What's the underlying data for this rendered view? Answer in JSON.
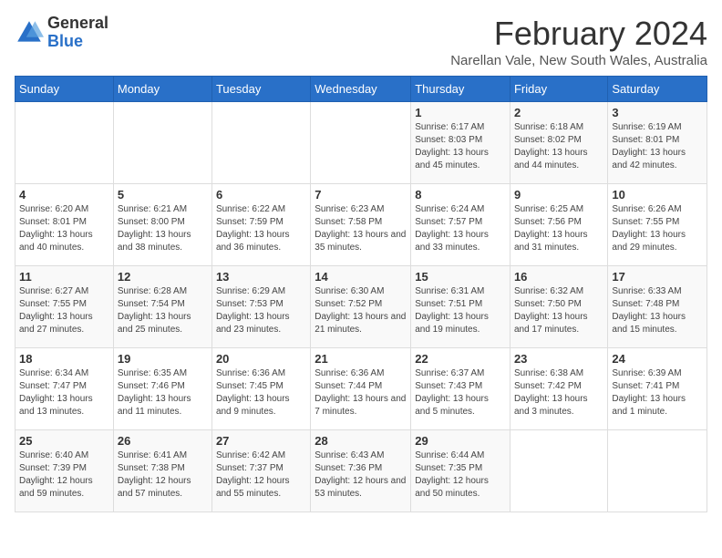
{
  "logo": {
    "general": "General",
    "blue": "Blue"
  },
  "title": "February 2024",
  "subtitle": "Narellan Vale, New South Wales, Australia",
  "days": [
    "Sunday",
    "Monday",
    "Tuesday",
    "Wednesday",
    "Thursday",
    "Friday",
    "Saturday"
  ],
  "weeks": [
    [
      {
        "date": "",
        "info": ""
      },
      {
        "date": "",
        "info": ""
      },
      {
        "date": "",
        "info": ""
      },
      {
        "date": "",
        "info": ""
      },
      {
        "date": "1",
        "info": "Sunrise: 6:17 AM\nSunset: 8:03 PM\nDaylight: 13 hours and 45 minutes."
      },
      {
        "date": "2",
        "info": "Sunrise: 6:18 AM\nSunset: 8:02 PM\nDaylight: 13 hours and 44 minutes."
      },
      {
        "date": "3",
        "info": "Sunrise: 6:19 AM\nSunset: 8:01 PM\nDaylight: 13 hours and 42 minutes."
      }
    ],
    [
      {
        "date": "4",
        "info": "Sunrise: 6:20 AM\nSunset: 8:01 PM\nDaylight: 13 hours and 40 minutes."
      },
      {
        "date": "5",
        "info": "Sunrise: 6:21 AM\nSunset: 8:00 PM\nDaylight: 13 hours and 38 minutes."
      },
      {
        "date": "6",
        "info": "Sunrise: 6:22 AM\nSunset: 7:59 PM\nDaylight: 13 hours and 36 minutes."
      },
      {
        "date": "7",
        "info": "Sunrise: 6:23 AM\nSunset: 7:58 PM\nDaylight: 13 hours and 35 minutes."
      },
      {
        "date": "8",
        "info": "Sunrise: 6:24 AM\nSunset: 7:57 PM\nDaylight: 13 hours and 33 minutes."
      },
      {
        "date": "9",
        "info": "Sunrise: 6:25 AM\nSunset: 7:56 PM\nDaylight: 13 hours and 31 minutes."
      },
      {
        "date": "10",
        "info": "Sunrise: 6:26 AM\nSunset: 7:55 PM\nDaylight: 13 hours and 29 minutes."
      }
    ],
    [
      {
        "date": "11",
        "info": "Sunrise: 6:27 AM\nSunset: 7:55 PM\nDaylight: 13 hours and 27 minutes."
      },
      {
        "date": "12",
        "info": "Sunrise: 6:28 AM\nSunset: 7:54 PM\nDaylight: 13 hours and 25 minutes."
      },
      {
        "date": "13",
        "info": "Sunrise: 6:29 AM\nSunset: 7:53 PM\nDaylight: 13 hours and 23 minutes."
      },
      {
        "date": "14",
        "info": "Sunrise: 6:30 AM\nSunset: 7:52 PM\nDaylight: 13 hours and 21 minutes."
      },
      {
        "date": "15",
        "info": "Sunrise: 6:31 AM\nSunset: 7:51 PM\nDaylight: 13 hours and 19 minutes."
      },
      {
        "date": "16",
        "info": "Sunrise: 6:32 AM\nSunset: 7:50 PM\nDaylight: 13 hours and 17 minutes."
      },
      {
        "date": "17",
        "info": "Sunrise: 6:33 AM\nSunset: 7:48 PM\nDaylight: 13 hours and 15 minutes."
      }
    ],
    [
      {
        "date": "18",
        "info": "Sunrise: 6:34 AM\nSunset: 7:47 PM\nDaylight: 13 hours and 13 minutes."
      },
      {
        "date": "19",
        "info": "Sunrise: 6:35 AM\nSunset: 7:46 PM\nDaylight: 13 hours and 11 minutes."
      },
      {
        "date": "20",
        "info": "Sunrise: 6:36 AM\nSunset: 7:45 PM\nDaylight: 13 hours and 9 minutes."
      },
      {
        "date": "21",
        "info": "Sunrise: 6:36 AM\nSunset: 7:44 PM\nDaylight: 13 hours and 7 minutes."
      },
      {
        "date": "22",
        "info": "Sunrise: 6:37 AM\nSunset: 7:43 PM\nDaylight: 13 hours and 5 minutes."
      },
      {
        "date": "23",
        "info": "Sunrise: 6:38 AM\nSunset: 7:42 PM\nDaylight: 13 hours and 3 minutes."
      },
      {
        "date": "24",
        "info": "Sunrise: 6:39 AM\nSunset: 7:41 PM\nDaylight: 13 hours and 1 minute."
      }
    ],
    [
      {
        "date": "25",
        "info": "Sunrise: 6:40 AM\nSunset: 7:39 PM\nDaylight: 12 hours and 59 minutes."
      },
      {
        "date": "26",
        "info": "Sunrise: 6:41 AM\nSunset: 7:38 PM\nDaylight: 12 hours and 57 minutes."
      },
      {
        "date": "27",
        "info": "Sunrise: 6:42 AM\nSunset: 7:37 PM\nDaylight: 12 hours and 55 minutes."
      },
      {
        "date": "28",
        "info": "Sunrise: 6:43 AM\nSunset: 7:36 PM\nDaylight: 12 hours and 53 minutes."
      },
      {
        "date": "29",
        "info": "Sunrise: 6:44 AM\nSunset: 7:35 PM\nDaylight: 12 hours and 50 minutes."
      },
      {
        "date": "",
        "info": ""
      },
      {
        "date": "",
        "info": ""
      }
    ]
  ]
}
